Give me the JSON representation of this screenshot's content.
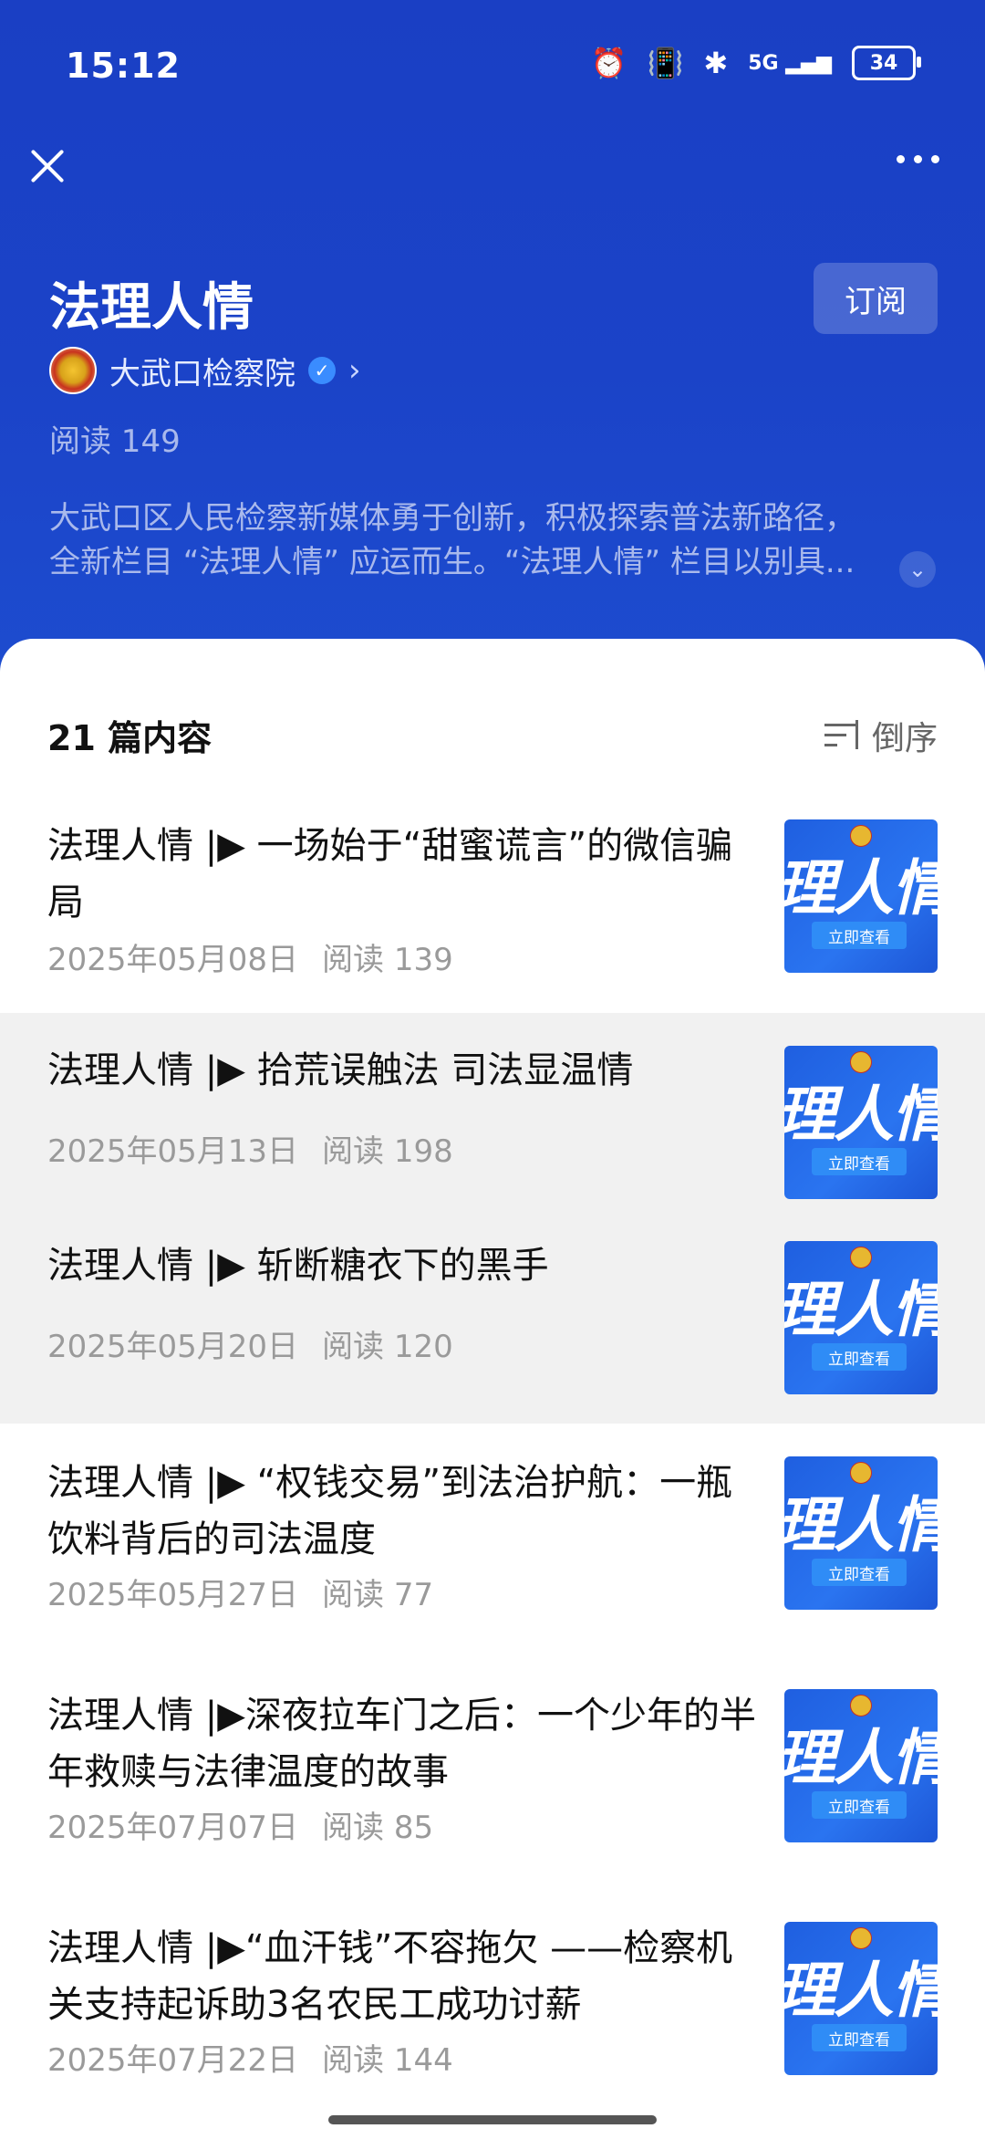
{
  "status_bar": {
    "time": "15:12",
    "battery": "34",
    "network": "5G"
  },
  "header": {
    "title": "法理人情",
    "subscribe_label": "订阅",
    "account_name": "大武口检察院",
    "reads": "阅读 149",
    "description_line1": "大武口区人民检察新媒体勇于创新，积极探索普法新路径，",
    "description_line2": "全新栏目 “法理人情” 应运而生。“法理人情” 栏目以别具..."
  },
  "list": {
    "count_label": "21 篇内容",
    "sort_label": "倒序",
    "thumb_text": "理人情",
    "thumb_button": "立即查看",
    "items": [
      {
        "title": "法理人情 |▶ 一场始于“甜蜜谎言”的微信骗局",
        "date": "2025年05月08日",
        "reads": "阅读 139"
      },
      {
        "title": "法理人情 |▶ 拾荒误触法 司法显温情",
        "date": "2025年05月13日",
        "reads": "阅读 198"
      },
      {
        "title": "法理人情 |▶ 斩断糖衣下的黑手",
        "date": "2025年05月20日",
        "reads": "阅读 120"
      },
      {
        "title": "法理人情 |▶ “权钱交易”到法治护航：一瓶饮料背后的司法温度",
        "date": "2025年05月27日",
        "reads": "阅读 77"
      },
      {
        "title": "法理人情 |▶深夜拉车门之后：一个少年的半年救赎与法律温度的故事",
        "date": "2025年07月07日",
        "reads": "阅读 85"
      },
      {
        "title": "法理人情 |▶“血汗钱”不容拖欠 ——检察机关支持起诉助3名农民工成功讨薪",
        "date": "2025年07月22日",
        "reads": "阅读 144"
      }
    ]
  }
}
